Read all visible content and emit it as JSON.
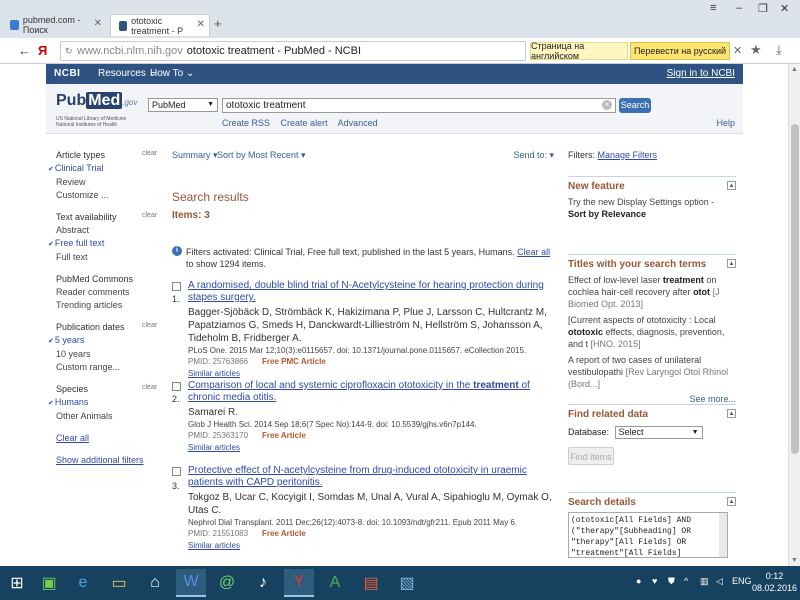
{
  "browser": {
    "tabs": [
      {
        "label": "pubmed.com - Поиск",
        "active": false
      },
      {
        "label": "ototoxic treatment - P",
        "active": true
      }
    ],
    "url_domain": "www.ncbi.nlm.nih.gov",
    "url_title": "ototoxic treatment - PubMed - NCBI",
    "translate_prompt": "Страница на английском",
    "translate_button": "Перевести на русский"
  },
  "ncbi": {
    "logo": "NCBI",
    "resources": "Resources",
    "howto": "How To",
    "signin": "Sign in to NCBI"
  },
  "pubmed": {
    "logo_pub": "Pub",
    "logo_med": "Med",
    "logo_gov": ".gov",
    "sub1": "US National Library of Medicine",
    "sub2": "National Institutes of Health",
    "db_value": "PubMed",
    "query": "ototoxic treatment",
    "search_btn": "Search",
    "links": [
      "Create RSS",
      "Create alert",
      "Advanced"
    ],
    "help": "Help"
  },
  "sidebar": {
    "clear": "clear",
    "groups": [
      {
        "title": "Article types",
        "has_clear": true,
        "items": [
          {
            "label": "Clinical Trial",
            "on": true
          },
          {
            "label": "Review",
            "on": false
          },
          {
            "label": "Customize ...",
            "on": false
          }
        ]
      },
      {
        "title": "Text availability",
        "has_clear": true,
        "items": [
          {
            "label": "Abstract",
            "on": false
          },
          {
            "label": "Free full text",
            "on": true
          },
          {
            "label": "Full text",
            "on": false
          }
        ]
      },
      {
        "title": "PubMed Commons",
        "has_clear": false,
        "items": [
          {
            "label": "Reader comments",
            "on": false
          },
          {
            "label": "Trending articles",
            "on": false
          }
        ]
      },
      {
        "title": "Publication dates",
        "has_clear": true,
        "items": [
          {
            "label": "5 years",
            "on": true
          },
          {
            "label": "10 years",
            "on": false
          },
          {
            "label": "Custom range...",
            "on": false
          }
        ]
      },
      {
        "title": "Species",
        "has_clear": true,
        "items": [
          {
            "label": "Humans",
            "on": true
          },
          {
            "label": "Other Animals",
            "on": false
          }
        ]
      }
    ],
    "clear_all": "Clear all",
    "show_additional": "Show additional filters"
  },
  "main": {
    "summary": "Summary",
    "sort": "Sort by Most Recent",
    "send_to": "Send to:",
    "results_title": "Search results",
    "items": "Items: 3",
    "filters_text": "Filters activated: Clinical Trial, Free full text, published in the last 5 years, Humans.",
    "filters_link": "Clear all",
    "filters_after": "to show 1294 items.",
    "results": [
      {
        "num": "1.",
        "title": "A randomised, double blind trial of N-Acetylcysteine for hearing protection during stapes surgery.",
        "authors": "Bagger-Sjöbäck D, Strömbäck K, Hakizimana P, Plue J, Larsson C, Hultcrantz M, Papatziamos G, Smeds H, Danckwardt-Lillieström N, Hellström S, Johansson A, Tideholm B, Fridberger A.",
        "citation": "PLoS One. 2015 Mar 12;10(3):e0115657. doi: 10.1371/journal.pone.0115657. eCollection 2015.",
        "pmid": "PMID: 25763866",
        "free": "Free PMC Article",
        "similar": "Similar articles"
      },
      {
        "num": "2.",
        "title_pre": "Comparison of local and systemic ciprofloxacin ototoxicity in the ",
        "title_bold": "treatment",
        "title_post": " of chronic media otitis.",
        "authors": "Samarei R.",
        "citation": "Glob J Health Sci. 2014 Sep 18;6(7 Spec No):144-9. doi: 10.5539/gjhs.v6n7p144.",
        "pmid": "PMID: 25363170",
        "free": "Free Article",
        "similar": "Similar articles"
      },
      {
        "num": "3.",
        "title": "Protective effect of N-acetylcysteine from drug-induced ototoxicity in uraemic patients with CAPD peritonitis.",
        "authors": "Tokgoz B, Ucar C, Kocyigit I, Somdas M, Unal A, Vural A, Sipahioglu M, Oymak O, Utas C.",
        "citation": "Nephrol Dial Transplant. 2011 Dec;26(12):4073-8. doi: 10.1093/ndt/gfr211. Epub 2011 May 6.",
        "pmid": "PMID: 21551083",
        "free": "Free Article",
        "similar": "Similar articles"
      }
    ]
  },
  "right": {
    "filters_label": "Filters:",
    "manage_filters": "Manage Filters",
    "new_feature_title": "New feature",
    "new_feature_text": "Try the new Display Settings option -",
    "new_feature_bold": "Sort by Relevance",
    "titles_header": "Titles with your search terms",
    "titles": [
      {
        "pre": "Effect of low-level laser ",
        "b1": "treatment",
        "mid": " on cochlea hair-cell recovery after ",
        "b2": "otot",
        "cit": "[J Biomed Opt. 2013]"
      },
      {
        "pre": "[Current aspects of ototoxicity : Local ",
        "b1": "ototoxic",
        "mid": " effects, diagnosis, prevention, and t",
        "b2": "",
        "cit": "[HNO. 2015]"
      },
      {
        "pre": "A report of two cases of unilateral vestibulopathi",
        "b1": "",
        "mid": "",
        "b2": "",
        "cit": "[Rev Laryngol Otol Rhinol (Bord...]"
      }
    ],
    "see_more": "See more...",
    "find_related_title": "Find related data",
    "database_label": "Database:",
    "database_value": "Select",
    "find_items": "Find items",
    "search_details_title": "Search details",
    "search_details": "(ototoxic[All Fields] AND (\"therapy\"[Subheading] OR \"therapy\"[All Fields] OR \"treatment\"[All Fields]"
  },
  "taskbar": {
    "lang": "ENG",
    "time": "0:12",
    "date": "08.02.2016"
  }
}
